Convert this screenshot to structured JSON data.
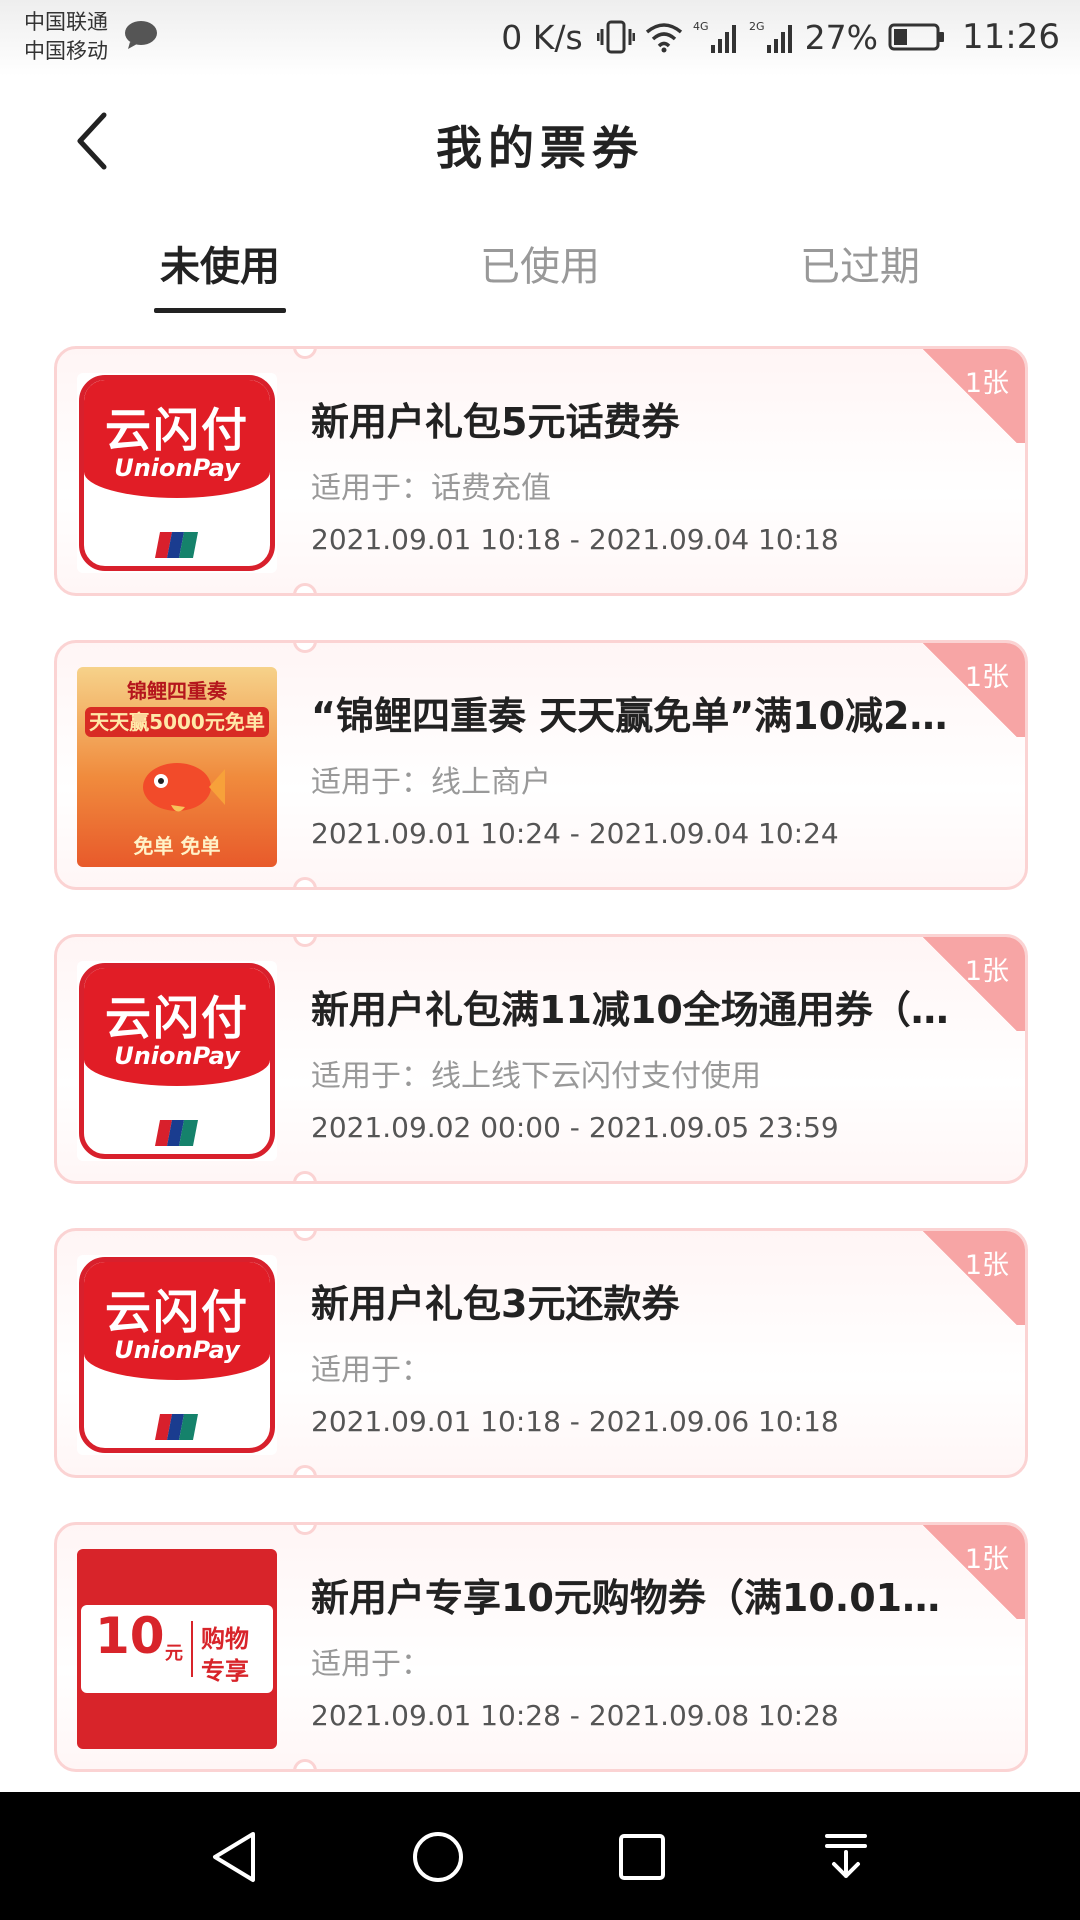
{
  "status_bar": {
    "carrier1": "中国联通",
    "carrier2": "中国移动",
    "speed": "0 K/s",
    "net1": "4G",
    "net2": "2G",
    "battery": "27%",
    "time": "11:26"
  },
  "header": {
    "title": "我的票券"
  },
  "tabs": [
    {
      "label": "未使用",
      "active": true
    },
    {
      "label": "已使用",
      "active": false
    },
    {
      "label": "已过期",
      "active": false
    }
  ],
  "coupons": [
    {
      "title": "新用户礼包5元话费券",
      "scope": "适用于：话费充值",
      "date": "2021.09.01 10:18 - 2021.09.04 10:18",
      "count": "1张",
      "thumb": {
        "type": "unionpay",
        "cn": "云闪付",
        "en": "UnionPay"
      }
    },
    {
      "title": "“锦鲤四重奏 天天赢免单”满10减2…",
      "scope": "适用于：线上商户",
      "date": "2021.09.01 10:24 - 2021.09.04 10:24",
      "count": "1张",
      "thumb": {
        "type": "koi",
        "banner": "锦鲤四重奏",
        "sub": "天天赢5000元免单",
        "bottom": "免单 免单"
      }
    },
    {
      "title": "新用户礼包满11减10全场通用券（…",
      "scope": "适用于：线上线下云闪付支付使用",
      "date": "2021.09.02 00:00 - 2021.09.05 23:59",
      "count": "1张",
      "thumb": {
        "type": "unionpay",
        "cn": "云闪付",
        "en": "UnionPay"
      }
    },
    {
      "title": "新用户礼包3元还款券",
      "scope": "适用于：",
      "date": "2021.09.01 10:18 - 2021.09.06 10:18",
      "count": "1张",
      "thumb": {
        "type": "unionpay",
        "cn": "云闪付",
        "en": "UnionPay"
      }
    },
    {
      "title": "新用户专享10元购物券（满10.01…",
      "scope": "适用于：",
      "date": "2021.09.01 10:28 - 2021.09.08 10:28",
      "count": "1张",
      "thumb": {
        "type": "ten",
        "num": "10",
        "unit": "元",
        "line1": "购物",
        "line2": "专享"
      }
    }
  ],
  "colors": {
    "accent_red": "#e11d26",
    "corner_pink": "#f7a5a5",
    "border_pink": "#fbd3d3"
  }
}
